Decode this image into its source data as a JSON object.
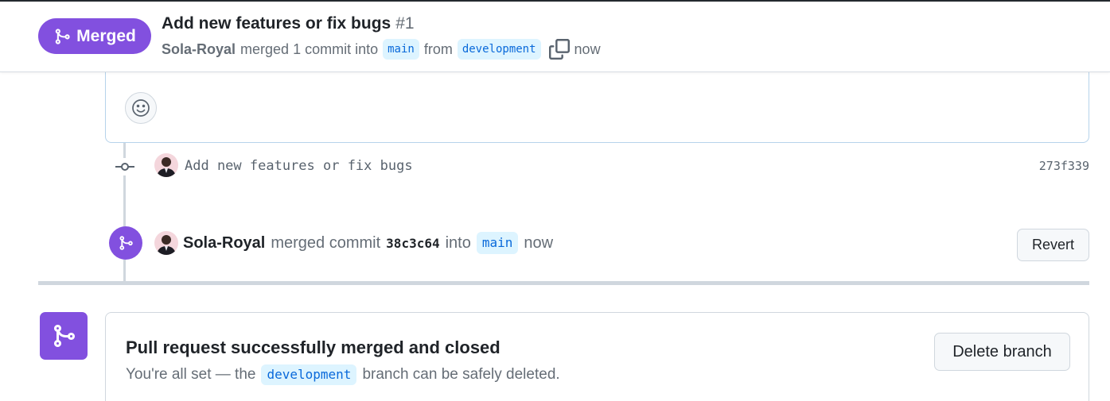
{
  "header": {
    "state_label": "Merged",
    "title": "Add new features or fix bugs",
    "number": "#1",
    "author": "Sola-Royal",
    "merged_text": "merged 1 commit into",
    "base_branch": "main",
    "from_text": "from",
    "head_branch": "development",
    "time": "now"
  },
  "timeline": {
    "commit": {
      "message": "Add new features or fix bugs",
      "sha": "273f339"
    },
    "merge_event": {
      "author": "Sola-Royal",
      "action": "merged commit",
      "sha": "38c3c64",
      "into_text": "into",
      "branch": "main",
      "time": "now",
      "revert_label": "Revert"
    }
  },
  "merge_box": {
    "title": "Pull request successfully merged and closed",
    "desc_prefix": "You're all set — the",
    "branch": "development",
    "desc_suffix": "branch can be safely deleted.",
    "delete_label": "Delete branch"
  },
  "colors": {
    "merged_purple": "#8250df",
    "branch_bg": "#ddf4ff",
    "branch_fg": "#0969da"
  }
}
